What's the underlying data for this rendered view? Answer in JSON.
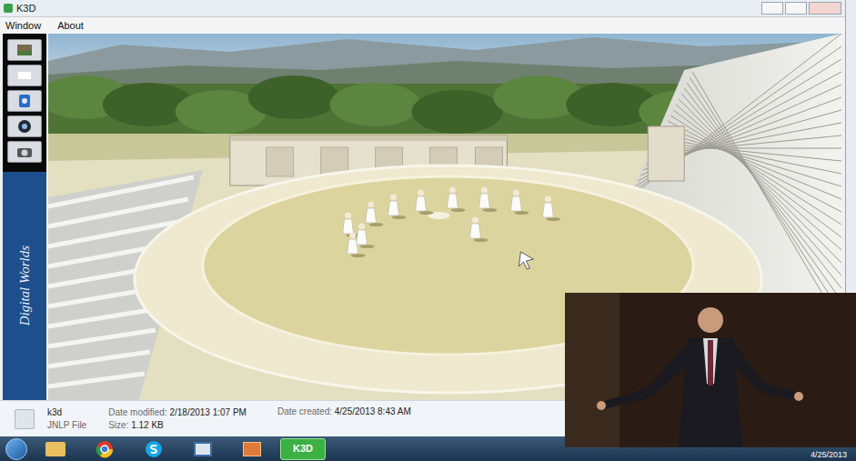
{
  "window": {
    "title": "K3D"
  },
  "menu": [
    {
      "label": "Window"
    },
    {
      "label": "About"
    }
  ],
  "sidebar": {
    "logo": "Digital Worlds"
  },
  "details": {
    "name": "k3d",
    "type": "JNLP File",
    "fields": [
      {
        "label": "Date modified:",
        "value": "2/18/2013 1:07 PM"
      },
      {
        "label": "Size:",
        "value": "1.12 KB"
      },
      {
        "label": "Date created:",
        "value": "4/25/2013 8:43 AM"
      }
    ]
  },
  "taskbar": {
    "buttons": [
      {
        "label": "K3D",
        "selected": true
      }
    ],
    "clock": "4/25/2013"
  }
}
